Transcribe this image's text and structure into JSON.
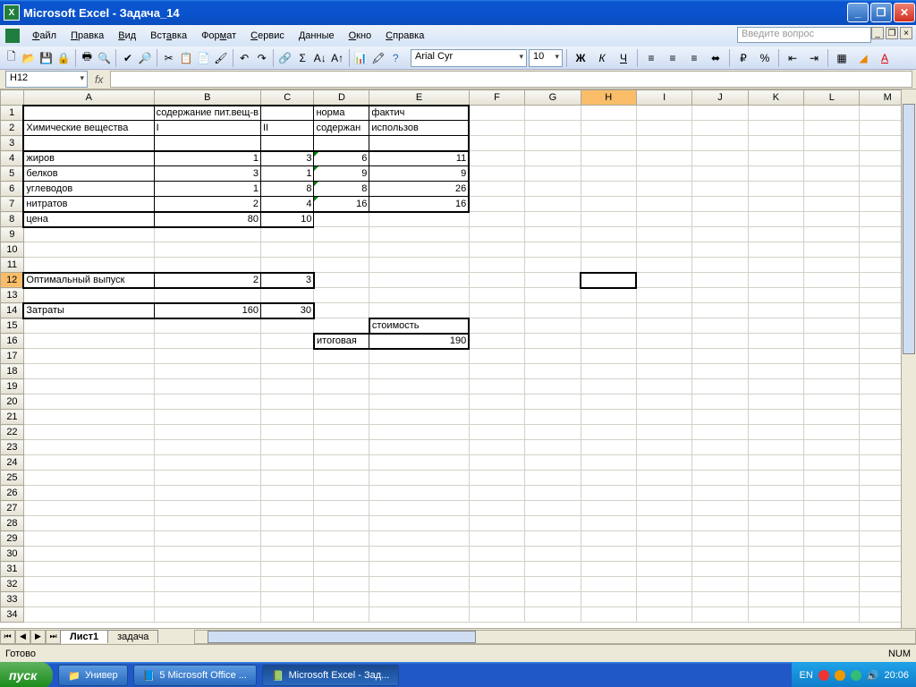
{
  "titlebar": {
    "title": "Microsoft Excel - Задача_14"
  },
  "menu": {
    "items": [
      "Файл",
      "Правка",
      "Вид",
      "Вставка",
      "Формат",
      "Сервис",
      "Данные",
      "Окно",
      "Справка"
    ],
    "ask_placeholder": "Введите вопрос"
  },
  "format_toolbar": {
    "font": "Arial Cyr",
    "size": "10"
  },
  "namebox": "H12",
  "formula": "",
  "columns": [
    "A",
    "B",
    "C",
    "D",
    "E",
    "F",
    "G",
    "H",
    "I",
    "J",
    "K",
    "L",
    "M"
  ],
  "active_col": "H",
  "active_row": 12,
  "cells": {
    "A2": "Химические вещества",
    "B1": "содержание пит.вещ-в",
    "D1": "норма",
    "E1": "фактич",
    "B2": "I",
    "C2": "II",
    "D2": "содержан",
    "E2": "использов",
    "A4": "жиров",
    "B4": "1",
    "C4": "3",
    "D4": "6",
    "E4": "11",
    "A5": "белков",
    "B5": "3",
    "C5": "1",
    "D5": "9",
    "E5": "9",
    "A6": "углеводов",
    "B6": "1",
    "C6": "8",
    "D6": "8",
    "E6": "26",
    "A7": "нитратов",
    "B7": "2",
    "C7": "4",
    "D7": "16",
    "E7": "16",
    "A8": "цена",
    "B8": "80",
    "C8": "10",
    "A12": "Оптимальный выпуск",
    "B12": "2",
    "C12": "3",
    "A14": "Затраты",
    "B14": "160",
    "C14": "30",
    "E15": "стоимость",
    "D16": "итоговая",
    "E16": "190"
  },
  "sheets": {
    "active": "Лист1",
    "other": "задача"
  },
  "status": {
    "ready": "Готово",
    "num": "NUM"
  },
  "taskbar": {
    "start": "пуск",
    "items": [
      "Универ",
      "5 Microsoft Office ...",
      "Microsoft Excel - Зад..."
    ],
    "lang": "EN",
    "time": "20:06"
  }
}
